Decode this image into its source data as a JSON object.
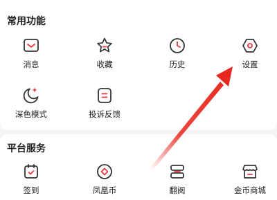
{
  "common": {
    "title": "常用功能",
    "items": [
      {
        "label": "消息",
        "icon": "mail-icon"
      },
      {
        "label": "收藏",
        "icon": "star-icon"
      },
      {
        "label": "历史",
        "icon": "clock-icon"
      },
      {
        "label": "设置",
        "icon": "settings-icon"
      },
      {
        "label": "深色模式",
        "icon": "moon-icon"
      },
      {
        "label": "投诉反馈",
        "icon": "feedback-icon"
      }
    ]
  },
  "platform": {
    "title": "平台服务",
    "items": [
      {
        "label": "签到",
        "icon": "check-in-icon"
      },
      {
        "label": "凤凰币",
        "icon": "coin-icon"
      },
      {
        "label": "翻阅",
        "icon": "read-icon"
      },
      {
        "label": "金币商城",
        "icon": "shop-icon"
      }
    ]
  },
  "colors": {
    "accent": "#e8383d",
    "icon_stroke": "#333333",
    "annotation_arrow": "#e8281e"
  }
}
